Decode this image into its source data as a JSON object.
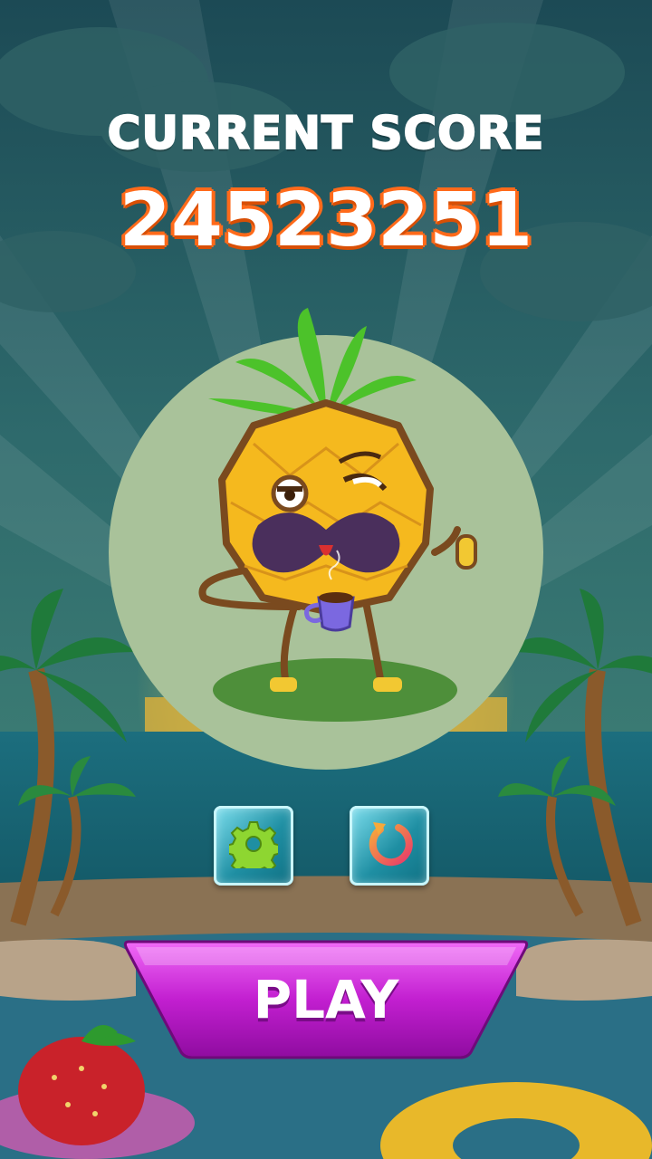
{
  "score": {
    "title": "CURRENT SCORE",
    "value": "24523251"
  },
  "buttons": {
    "settings_icon": "gear-icon",
    "restart_icon": "restart-arrow-icon",
    "play_label": "PLAY"
  },
  "colors": {
    "score_outline": "#ff6a1a",
    "play_button": "#c21fd0",
    "gear": "#8ed631",
    "circle_backdrop": "#a9c29a"
  }
}
